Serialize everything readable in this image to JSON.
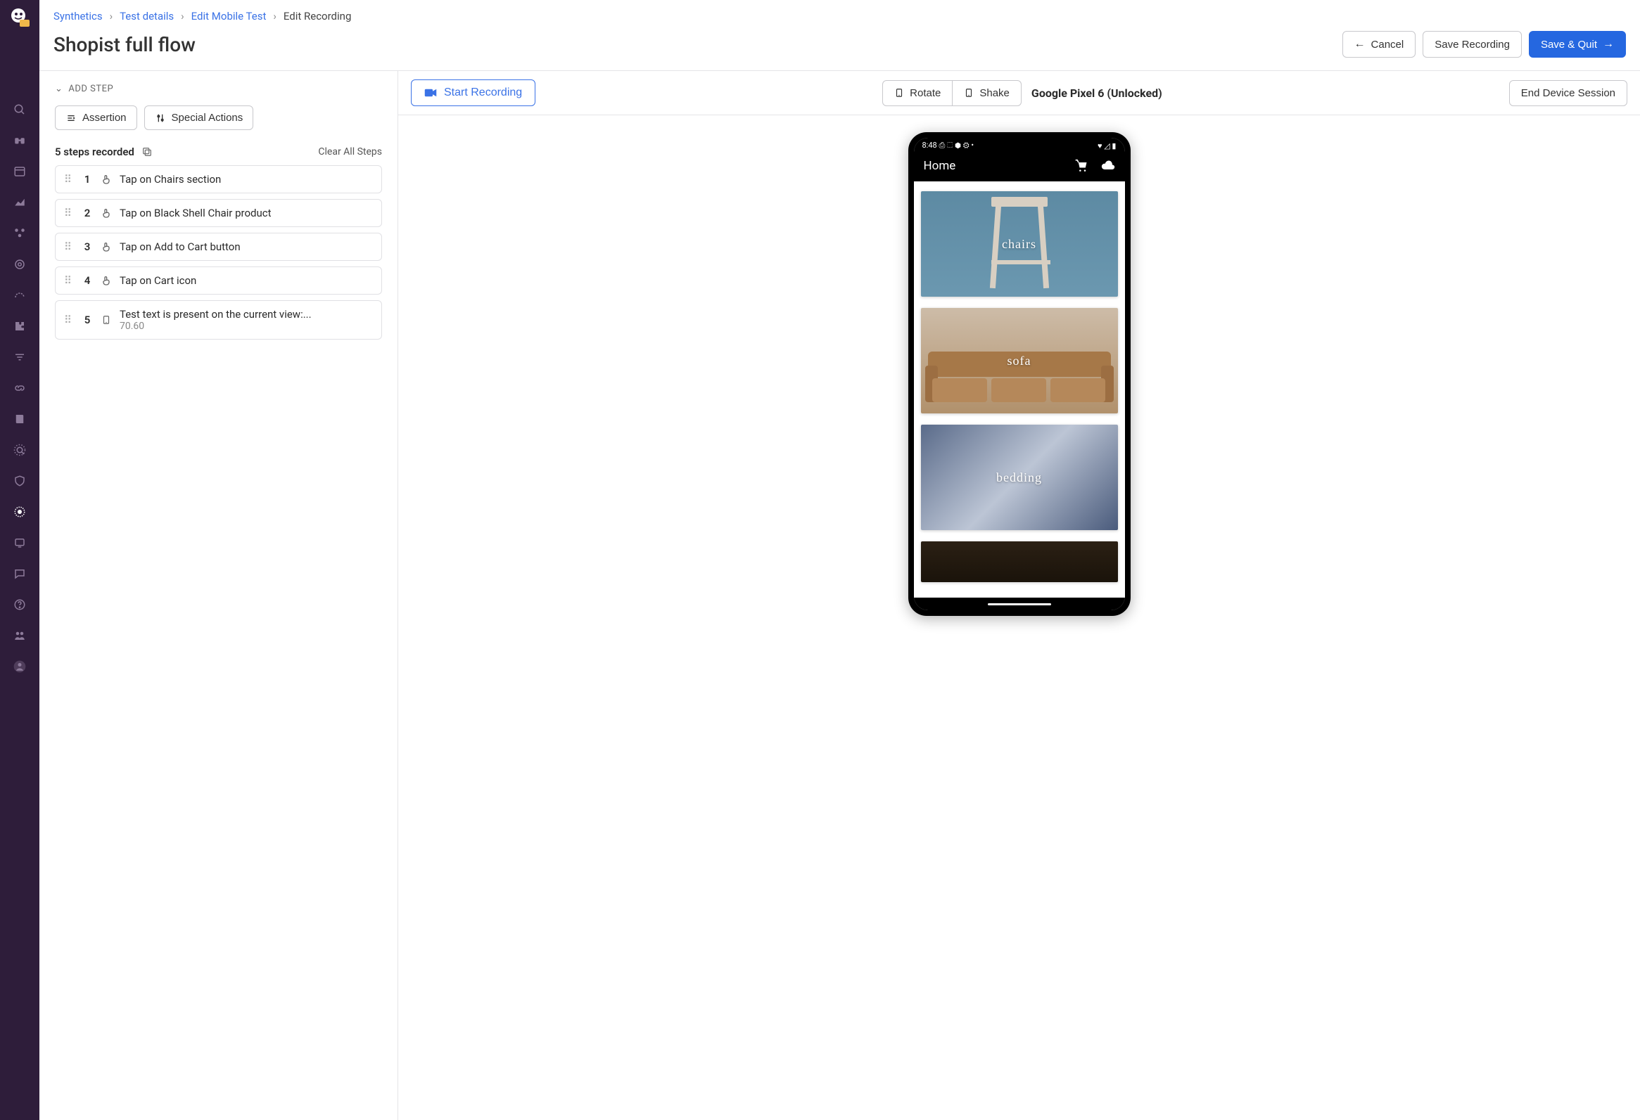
{
  "breadcrumb": {
    "items": [
      "Synthetics",
      "Test details",
      "Edit Mobile Test"
    ],
    "current": "Edit Recording"
  },
  "page_title": "Shopist full flow",
  "title_actions": {
    "cancel": "Cancel",
    "save": "Save Recording",
    "save_quit": "Save & Quit"
  },
  "left": {
    "add_step_label": "ADD STEP",
    "assertion_btn": "Assertion",
    "special_btn": "Special Actions",
    "steps_recorded": "5 steps recorded",
    "clear_all": "Clear All Steps",
    "steps": [
      {
        "n": "1",
        "text": "Tap on Chairs section"
      },
      {
        "n": "2",
        "text": "Tap on Black Shell Chair product"
      },
      {
        "n": "3",
        "text": "Tap on Add to Cart button"
      },
      {
        "n": "4",
        "text": "Tap on Cart icon"
      },
      {
        "n": "5",
        "text": "Test text is present on the current view:...",
        "sub": "70.60"
      }
    ]
  },
  "device_toolbar": {
    "start_recording": "Start Recording",
    "rotate": "Rotate",
    "shake": "Shake",
    "device": "Google Pixel 6 (Unlocked)",
    "end_session": "End Device Session"
  },
  "phone": {
    "status_time": "8:48",
    "status_icons_left": "⎙ ⬚ ⬢ ⚙ •",
    "status_icons_right": "♥ ◿ ▮",
    "app_title": "Home",
    "categories": {
      "chairs": "chairs",
      "sofa": "sofa",
      "bedding": "bedding"
    }
  }
}
